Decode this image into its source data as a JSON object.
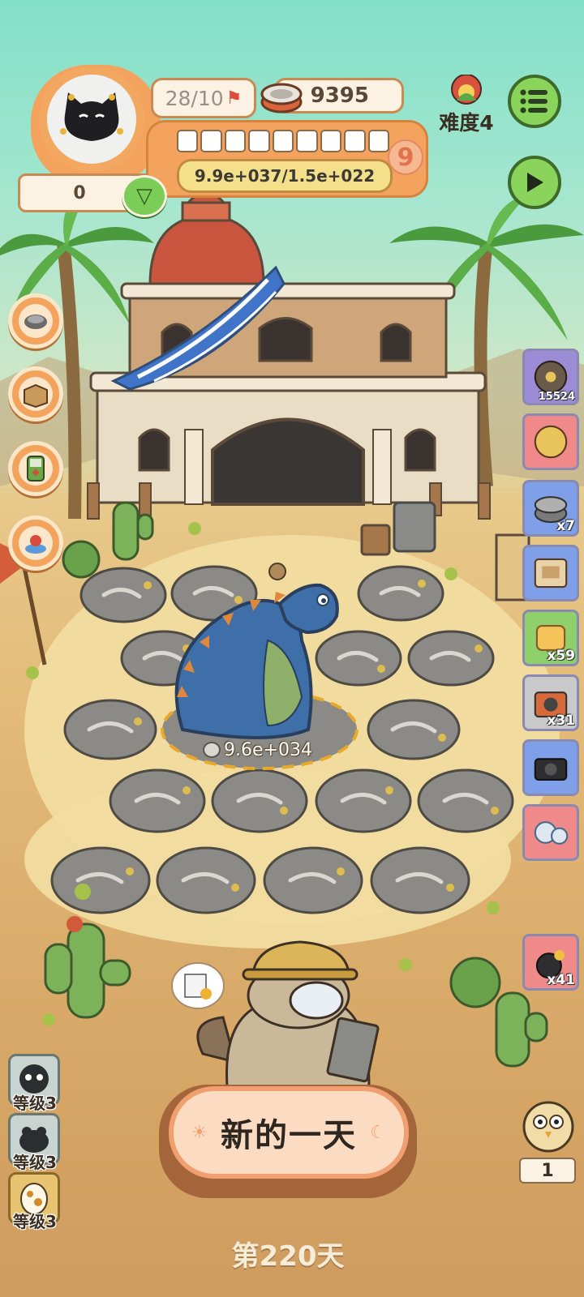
{
  "hud": {
    "food_progress": "28/10",
    "coins": "9395",
    "currency_bar": "9.9e+037/1.5e+022",
    "level_badge": "9",
    "left_counter": "0",
    "difficulty": "难度4",
    "progress_segments": 9
  },
  "digsite": {
    "dino_value": "9.6e+034"
  },
  "items": [
    {
      "icon": "stone-wheel-icon",
      "count": "15524",
      "bg": "#9c8cd6"
    },
    {
      "icon": "plus-two-stone-icon",
      "count": "",
      "bg": "#f08a8a"
    },
    {
      "icon": "can-icon",
      "count": "x7",
      "bg": "#7fa0e8"
    },
    {
      "icon": "machine-icon",
      "count": "",
      "bg": "#7fa0e8"
    },
    {
      "icon": "scroll-icon",
      "count": "x59",
      "bg": "#8fd06a"
    },
    {
      "icon": "radio-icon",
      "count": "x31",
      "bg": "#c9c9c9"
    },
    {
      "icon": "camera-icon",
      "count": "",
      "bg": "#7fa0e8"
    },
    {
      "icon": "fossil-creature-icon",
      "count": "",
      "bg": "#f08a8a"
    },
    {
      "icon": "bomb-bag-icon",
      "count": "x41",
      "bg": "#f08a8a"
    }
  ],
  "levels": [
    {
      "label": "等级3",
      "icon": "ghost-icon"
    },
    {
      "label": "等级3",
      "icon": "frog-icon"
    },
    {
      "label": "等级3",
      "icon": "spotted-egg-icon"
    }
  ],
  "bottom": {
    "new_day_label": "新的一天",
    "day_label": "第220天",
    "corner_count": "1"
  }
}
